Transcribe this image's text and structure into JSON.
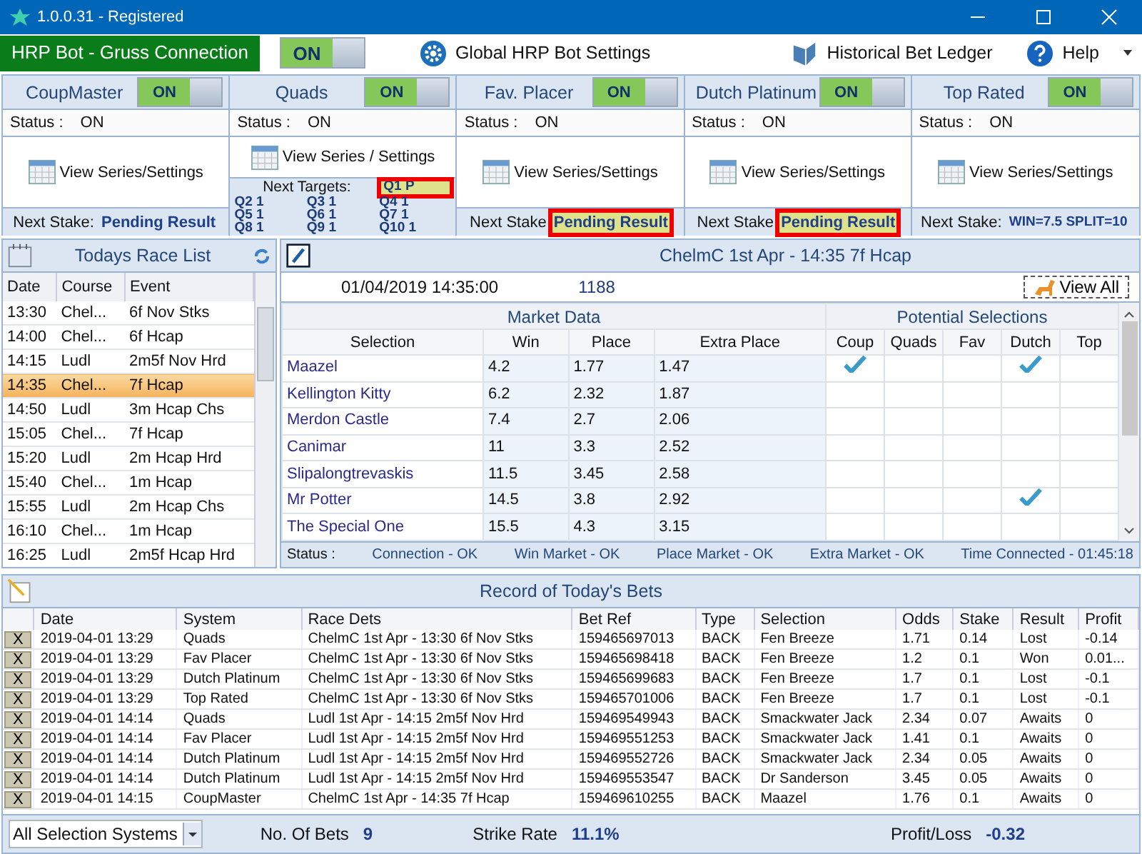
{
  "window": {
    "title": "1.0.0.31 - Registered"
  },
  "toolbar": {
    "connection": "HRP Bot - Gruss Connection",
    "toggle": {
      "label": "ON",
      "on": true
    },
    "global_settings": "Global HRP Bot Settings",
    "ledger": "Historical Bet Ledger",
    "help": "Help"
  },
  "systems": [
    {
      "name": "CoupMaster",
      "toggle": {
        "label": "ON",
        "on": true
      },
      "status_label": "Status :",
      "status": "ON",
      "view": "View Series/Settings",
      "next_stake_label": "Next Stake:",
      "next_stake": "Pending Result",
      "highlighted": false
    },
    {
      "name": "Quads",
      "toggle": {
        "label": "ON",
        "on": true
      },
      "status_label": "Status :",
      "status": "ON",
      "view": "View Series / Settings",
      "targets_label": "Next Targets:",
      "targets": [
        {
          "label": "Q1",
          "value": "P",
          "highlighted": true
        },
        {
          "label": "Q2",
          "value": "1",
          "highlighted": false
        },
        {
          "label": "Q3",
          "value": "1",
          "highlighted": false
        },
        {
          "label": "Q4",
          "value": "1",
          "highlighted": false
        },
        {
          "label": "Q5",
          "value": "1",
          "highlighted": false
        },
        {
          "label": "Q6",
          "value": "1",
          "highlighted": false
        },
        {
          "label": "Q7",
          "value": "1",
          "highlighted": false
        },
        {
          "label": "Q8",
          "value": "1",
          "highlighted": false
        },
        {
          "label": "Q9",
          "value": "1",
          "highlighted": false
        },
        {
          "label": "Q10",
          "value": "1",
          "highlighted": false
        }
      ]
    },
    {
      "name": "Fav. Placer",
      "toggle": {
        "label": "ON",
        "on": true
      },
      "status_label": "Status :",
      "status": "ON",
      "view": "View Series/Settings",
      "next_stake_label": "Next Stake",
      "next_stake": "Pending Result",
      "highlighted": true
    },
    {
      "name": "Dutch Platinum",
      "toggle": {
        "label": "ON",
        "on": true
      },
      "status_label": "Status :",
      "status": "ON",
      "view": "View Series/Settings",
      "next_stake_label": "Next Stake",
      "next_stake": "Pending Result",
      "highlighted": true
    },
    {
      "name": "Top Rated",
      "toggle": {
        "label": "ON",
        "on": true
      },
      "status_label": "Status :",
      "status": "ON",
      "view": "View Series/Settings",
      "next_stake_label": "Next Stake:",
      "next_stake": "WIN=7.5 SPLIT=10",
      "highlighted": false
    }
  ],
  "race_list": {
    "title": "Todays Race List",
    "columns": [
      "Date",
      "Course",
      "Event"
    ],
    "rows": [
      {
        "cells": [
          "13:30",
          "Chel...",
          "6f Nov Stks"
        ],
        "selected": false
      },
      {
        "cells": [
          "14:00",
          "Chel...",
          "6f Hcap"
        ],
        "selected": false
      },
      {
        "cells": [
          "14:15",
          "Ludl",
          "2m5f Nov Hrd"
        ],
        "selected": false
      },
      {
        "cells": [
          "14:35",
          "Chel...",
          "7f Hcap"
        ],
        "selected": true
      },
      {
        "cells": [
          "14:50",
          "Ludl",
          "3m Hcap Chs"
        ],
        "selected": false
      },
      {
        "cells": [
          "15:05",
          "Chel...",
          "7f Hcap"
        ],
        "selected": false
      },
      {
        "cells": [
          "15:20",
          "Ludl",
          "2m Hcap Hrd"
        ],
        "selected": false
      },
      {
        "cells": [
          "15:40",
          "Chel...",
          "1m Hcap"
        ],
        "selected": false
      },
      {
        "cells": [
          "15:55",
          "Ludl",
          "2m Hcap Chs"
        ],
        "selected": false
      },
      {
        "cells": [
          "16:10",
          "Chel...",
          "1m Hcap"
        ],
        "selected": false
      },
      {
        "cells": [
          "16:25",
          "Ludl",
          "2m5f Hcap Hrd"
        ],
        "selected": false
      }
    ]
  },
  "market": {
    "title": "ChelmC  1st Apr - 14:35 7f Hcap",
    "datetime": "01/04/2019 14:35:00",
    "market_id": "1188",
    "view_all": "View All",
    "market_data_title": "Market Data",
    "selections_title": "Potential Selections",
    "columns": [
      "Selection",
      "Win",
      "Place",
      "Extra Place"
    ],
    "pick_columns": [
      "Coup",
      "Quads",
      "Fav",
      "Dutch",
      "Top"
    ],
    "rows": [
      {
        "cells": [
          "Maazel",
          "4.2",
          "1.77",
          "1.47"
        ],
        "picks": [
          true,
          false,
          false,
          true,
          false
        ]
      },
      {
        "cells": [
          "Kellington Kitty",
          "6.2",
          "2.32",
          "1.87"
        ],
        "picks": [
          false,
          false,
          false,
          false,
          false
        ]
      },
      {
        "cells": [
          "Merdon Castle",
          "7.4",
          "2.7",
          "2.06"
        ],
        "picks": [
          false,
          false,
          false,
          false,
          false
        ]
      },
      {
        "cells": [
          "Canimar",
          "11",
          "3.3",
          "2.52"
        ],
        "picks": [
          false,
          false,
          false,
          false,
          false
        ]
      },
      {
        "cells": [
          "Slipalongtrevaskis",
          "11.5",
          "3.45",
          "2.58"
        ],
        "picks": [
          false,
          false,
          false,
          false,
          false
        ]
      },
      {
        "cells": [
          "Mr Potter",
          "14.5",
          "3.8",
          "2.92"
        ],
        "picks": [
          false,
          false,
          false,
          true,
          false
        ]
      },
      {
        "cells": [
          "The Special One",
          "15.5",
          "4.3",
          "3.15"
        ],
        "picks": [
          false,
          false,
          false,
          false,
          false
        ]
      }
    ],
    "status_label": "Status :",
    "status_items": [
      "Connection - OK",
      "Win Market - OK",
      "Place Market - OK",
      "Extra Market - OK",
      "Time Connected - 01:45:18"
    ]
  },
  "bets": {
    "title": "Record of Today's Bets",
    "columns": [
      "Date",
      "System",
      "Race Dets",
      "Bet Ref",
      "Type",
      "Selection",
      "Odds",
      "Stake",
      "Result",
      "Profit"
    ],
    "rows": [
      {
        "delete": "X",
        "cells": [
          "2019-04-01 13:29",
          "Quads",
          "ChelmC  1st Apr - 13:30 6f Nov Stks",
          "159465697013",
          "BACK",
          "Fen Breeze",
          "1.71",
          "0.14",
          "Lost",
          "-0.14"
        ]
      },
      {
        "delete": "X",
        "cells": [
          "2019-04-01 13:29",
          "Fav Placer",
          "ChelmC  1st Apr - 13:30 6f Nov Stks",
          "159465698418",
          "BACK",
          "Fen Breeze",
          "1.2",
          "0.1",
          "Won",
          "0.01..."
        ]
      },
      {
        "delete": "X",
        "cells": [
          "2019-04-01 13:29",
          "Dutch Platinum",
          "ChelmC  1st Apr - 13:30 6f Nov Stks",
          "159465699683",
          "BACK",
          "Fen Breeze",
          "1.7",
          "0.1",
          "Lost",
          "-0.1"
        ]
      },
      {
        "delete": "X",
        "cells": [
          "2019-04-01 13:29",
          "Top Rated",
          "ChelmC  1st Apr - 13:30 6f Nov Stks",
          "159465701006",
          "BACK",
          "Fen Breeze",
          "1.7",
          "0.1",
          "Lost",
          "-0.1"
        ]
      },
      {
        "delete": "X",
        "cells": [
          "2019-04-01 14:14",
          "Quads",
          "Ludl  1st Apr - 14:15 2m5f Nov Hrd",
          "159469549943",
          "BACK",
          "Smackwater Jack",
          "2.34",
          "0.07",
          "Awaits",
          "0"
        ]
      },
      {
        "delete": "X",
        "cells": [
          "2019-04-01 14:14",
          "Fav Placer",
          "Ludl  1st Apr - 14:15 2m5f Nov Hrd",
          "159469551253",
          "BACK",
          "Smackwater Jack",
          "1.41",
          "0.1",
          "Awaits",
          "0"
        ]
      },
      {
        "delete": "X",
        "cells": [
          "2019-04-01 14:14",
          "Dutch Platinum",
          "Ludl  1st Apr - 14:15 2m5f Nov Hrd",
          "159469552726",
          "BACK",
          "Smackwater Jack",
          "2.34",
          "0.05",
          "Awaits",
          "0"
        ]
      },
      {
        "delete": "X",
        "cells": [
          "2019-04-01 14:14",
          "Dutch Platinum",
          "Ludl  1st Apr - 14:15 2m5f Nov Hrd",
          "159469553547",
          "BACK",
          "Dr Sanderson",
          "3.45",
          "0.05",
          "Awaits",
          "0"
        ]
      },
      {
        "delete": "X",
        "cells": [
          "2019-04-01 14:15",
          "CoupMaster",
          "ChelmC  1st Apr - 14:35 7f Hcap",
          "159469610255",
          "BACK",
          "Maazel",
          "1.76",
          "0.1",
          "Awaits",
          "0"
        ]
      }
    ],
    "filter": "All Selection Systems",
    "count_label": "No. Of Bets",
    "count": "9",
    "strike_label": "Strike Rate",
    "strike": "11.1%",
    "pl_label": "Profit/Loss",
    "pl": "-0.32"
  }
}
